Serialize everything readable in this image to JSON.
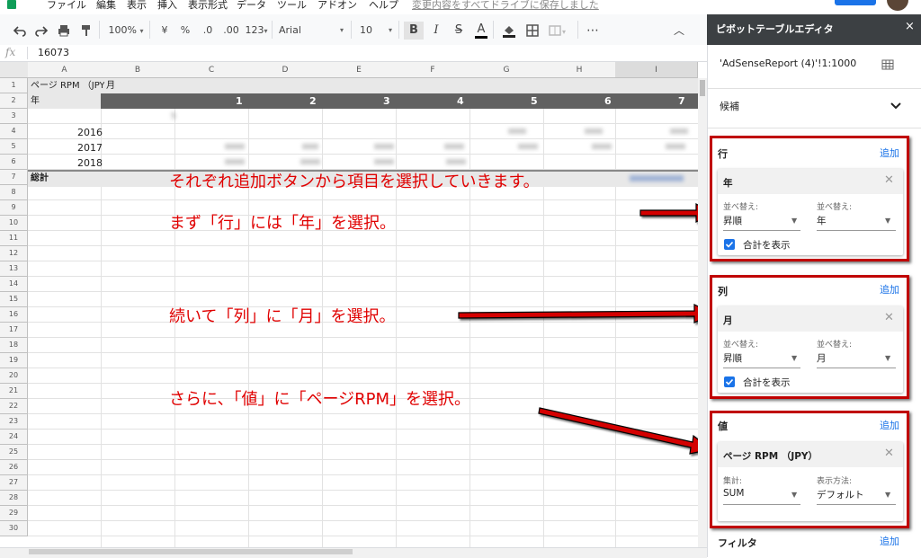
{
  "menu": {
    "items": [
      "ファイル",
      "編集",
      "表示",
      "挿入",
      "表示形式",
      "データ",
      "ツール",
      "アドオン",
      "ヘルプ"
    ],
    "save_status": "変更内容をすべてドライブに保存しました"
  },
  "toolbar": {
    "zoom": "100%",
    "currency": "¥",
    "percent": "%",
    "decimal_decrease": ".0",
    "decimal_increase": ".00",
    "number_format": "123",
    "font": "Arial",
    "font_size": "10",
    "bold": "B",
    "italic": "I",
    "strike": "S",
    "text_color": "A",
    "more": "⋯",
    "collapse": "︿"
  },
  "formula_bar": {
    "fx": "fx",
    "value": "16073"
  },
  "grid": {
    "columns": [
      "A",
      "B",
      "C",
      "D",
      "E",
      "F",
      "G",
      "H",
      "I"
    ],
    "rows": [
      "1",
      "2",
      "3",
      "4",
      "5",
      "6",
      "7",
      "8",
      "9",
      "10",
      "11",
      "12",
      "13",
      "14",
      "15",
      "16",
      "17",
      "18",
      "19",
      "20",
      "21",
      "22",
      "23",
      "24",
      "25",
      "26",
      "27",
      "28",
      "29",
      "30"
    ],
    "a1": "ページ RPM （JPY）",
    "b1": "月",
    "a2": "年",
    "month_headers": [
      "1",
      "2",
      "3",
      "4",
      "5",
      "6",
      "7"
    ],
    "years": [
      "2016",
      "2017",
      "2018"
    ],
    "a7": "総計",
    "c3": "5"
  },
  "annotations": {
    "line1": "それぞれ追加ボタンから項目を選択していきます。",
    "line2": "まず「行」には「年」を選択。",
    "line3": "続いて「列」に「月」を選択。",
    "line4": "さらに、「値」に「ページRPM」を選択。"
  },
  "pivot_editor": {
    "title": "ピボットテーブルエディタ",
    "close": "×",
    "range": "'AdSenseReport (4)'!1:1000",
    "suggest": "候補",
    "rows": {
      "label": "行",
      "add": "追加",
      "field": "年",
      "sort_label": "並べ替え:",
      "sort_value": "昇順",
      "sortby_label": "並べ替え:",
      "sortby_value": "年",
      "show_totals": "合計を表示"
    },
    "columns": {
      "label": "列",
      "add": "追加",
      "field": "月",
      "sort_label": "並べ替え:",
      "sort_value": "昇順",
      "sortby_label": "並べ替え:",
      "sortby_value": "月",
      "show_totals": "合計を表示"
    },
    "values": {
      "label": "値",
      "add": "追加",
      "field": "ページ RPM （JPY）",
      "summarize_label": "集計:",
      "summarize_value": "SUM",
      "show_as_label": "表示方法:",
      "show_as_value": "デフォルト"
    },
    "filters": {
      "label": "フィルタ",
      "add": "追加"
    }
  },
  "colors": {
    "accent": "#1a73e8",
    "annotation_red": "#e00000",
    "pivot_header": "#616161",
    "panel_header": "#3c4043"
  }
}
